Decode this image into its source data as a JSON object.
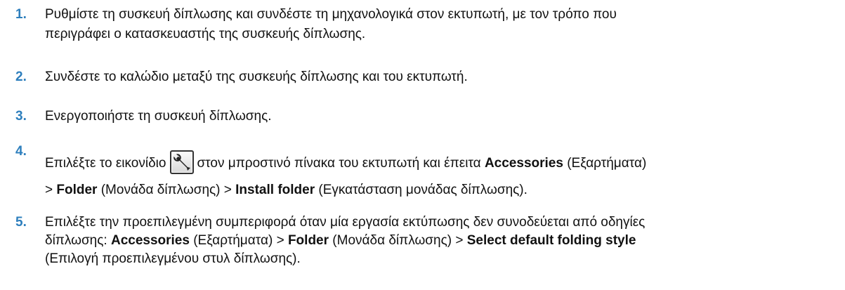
{
  "steps": [
    {
      "number": "1.",
      "line1": "Ρυθμίστε τη συσκευή δίπλωσης και συνδέστε τη μηχανολογικά στον εκτυπωτή, με τον τρόπο που",
      "line2": "περιγράφει ο κατασκευαστής της συσκευής δίπλωσης."
    },
    {
      "number": "2.",
      "text": "Συνδέστε το καλώδιο μεταξύ της συσκευής δίπλωσης και του εκτυπωτή."
    },
    {
      "number": "3.",
      "text": "Ενεργοποιήστε τη συσκευή δίπλωσης."
    },
    {
      "number": "4.",
      "before_icon": "Επιλέξτε το εικονίδιο",
      "icon": "wrench-icon",
      "after_icon": "στον μπροστινό πίνακα του εκτυπωτή και έπειτα",
      "accessories": "Accessories",
      "accessories_gr": " (Εξαρτήματα)",
      "sep1": "> ",
      "folder": "Folder",
      "folder_gr": " (Μονάδα δίπλωσης) > ",
      "install_folder": "Install folder",
      "install_folder_gr": " (Εγκατάσταση μονάδας δίπλωσης)."
    },
    {
      "number": "5.",
      "line1": "Επιλέξτε την προεπιλεγμένη συμπεριφορά όταν μία εργασία εκτύπωσης δεν συνοδεύεται από οδηγίες",
      "line2_prefix": "δίπλωσης: ",
      "accessories": "Accessories",
      "accessories_gr": " (Εξαρτήματα) > ",
      "folder": "Folder",
      "folder_gr": " (Μονάδα δίπλωσης) > ",
      "select_default": "Select default folding style",
      "line3": "(Επιλογή προεπιλεγμένου στυλ δίπλωσης)."
    }
  ],
  "colors": {
    "number": "#2e7fbd",
    "text": "#111111"
  }
}
